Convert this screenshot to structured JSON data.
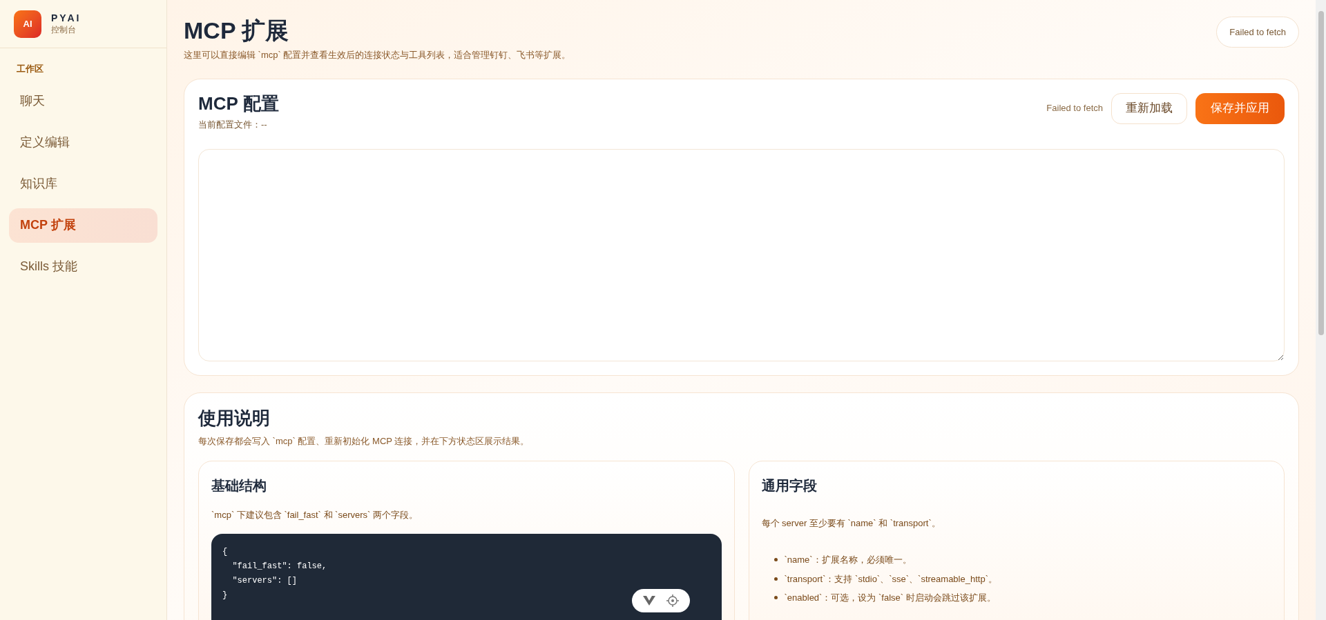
{
  "sidebar": {
    "logo": "AI",
    "brand": "PYAI",
    "subtitle": "控制台",
    "section": "工作区",
    "items": [
      {
        "label": "聊天",
        "selected": false
      },
      {
        "label": "定义编辑",
        "selected": false
      },
      {
        "label": "知识库",
        "selected": false
      },
      {
        "label": "MCP 扩展",
        "selected": true
      },
      {
        "label": "Skills 技能",
        "selected": false
      }
    ]
  },
  "header": {
    "title": "MCP 扩展",
    "description": "这里可以直接编辑 `mcp` 配置并查看生效后的连接状态与工具列表，适合管理钉钉、飞书等扩展。",
    "status": "Failed to fetch"
  },
  "config": {
    "title": "MCP 配置",
    "file_label": "当前配置文件：--",
    "status": "Failed to fetch",
    "reload_button": "重新加载",
    "save_button": "保存并应用"
  },
  "instructions": {
    "title": "使用说明",
    "description": "每次保存都会写入 `mcp` 配置、重新初始化 MCP 连接，并在下方状态区展示结果。",
    "basic": {
      "title": "基础结构",
      "text": "`mcp` 下建议包含 `fail_fast` 和 `servers` 两个字段。",
      "code": [
        "{",
        "  \"fail_fast\": false,",
        "  \"servers\": []",
        "}"
      ]
    },
    "fields": {
      "title": "通用字段",
      "text": "每个 server 至少要有 `name` 和 `transport`。",
      "bullets": [
        "`name`：扩展名称，必须唯一。",
        "`transport`：支持 `stdio`、`sse`、`streamable_http`。",
        "`enabled`：可选，设为 `false` 时启动会跳过该扩展。"
      ]
    }
  }
}
